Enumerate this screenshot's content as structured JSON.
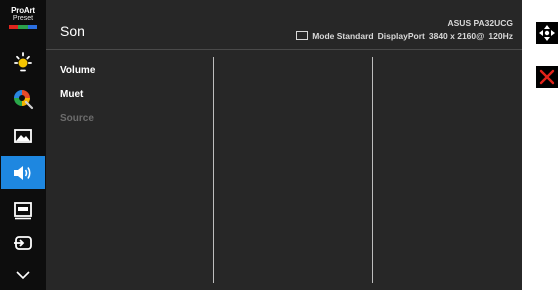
{
  "proart": {
    "line1": "ProArt",
    "line2": "Preset",
    "colors": [
      "#e0261d",
      "#2ba24c",
      "#2b6fe0"
    ]
  },
  "sidebar": {
    "items": [
      {
        "icon": "brightness-icon"
      },
      {
        "icon": "color-palette-icon"
      },
      {
        "icon": "image-icon"
      },
      {
        "icon": "speaker-icon",
        "active": true
      },
      {
        "icon": "pip-icon"
      },
      {
        "icon": "input-select-icon"
      },
      {
        "icon": "chevron-down-icon"
      }
    ]
  },
  "header": {
    "title": "Son",
    "model": "ASUS PA32UCG",
    "mode": "Mode Standard",
    "input": "DisplayPort",
    "resolution": "3840 x 2160@",
    "refresh": "120Hz"
  },
  "menu": {
    "items": [
      {
        "label": "Volume",
        "enabled": true
      },
      {
        "label": "Muet",
        "enabled": true
      },
      {
        "label": "Source",
        "enabled": false
      }
    ]
  },
  "side_buttons": [
    {
      "icon": "navigate-icon"
    },
    {
      "icon": "close-icon"
    }
  ],
  "colors": {
    "accent": "#1e87e0",
    "panel": "#272727",
    "close": "#e2231a"
  }
}
